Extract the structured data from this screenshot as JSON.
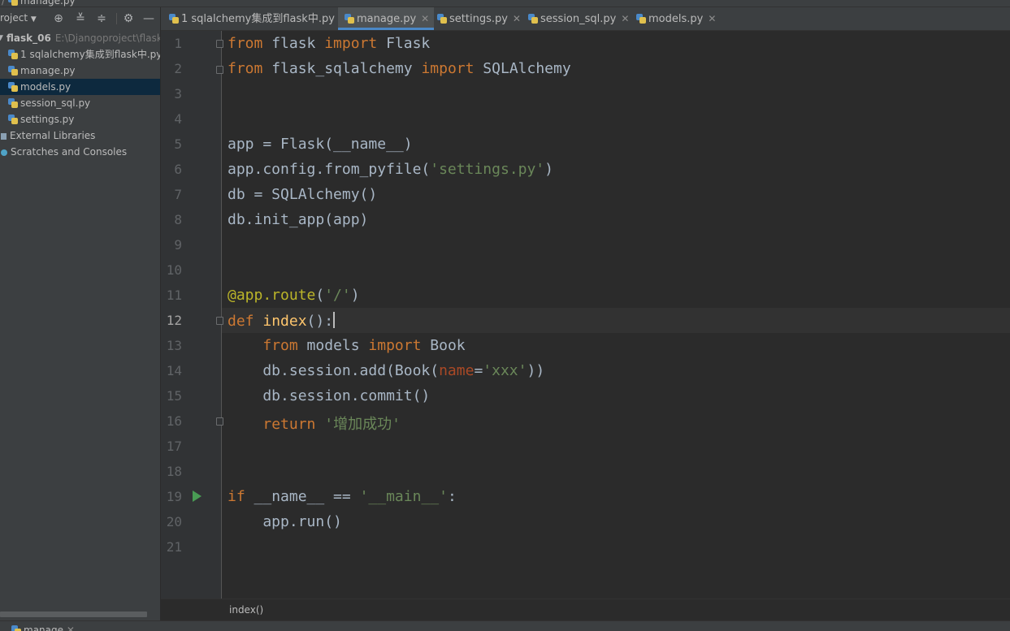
{
  "navbar": {
    "file": "manage.py"
  },
  "project_panel": {
    "title": "roject",
    "root_name": "flask_06",
    "root_path": "E:\\Djangoproject\\flask_",
    "files": [
      "1 sqlalchemy集成到flask中.py",
      "manage.py",
      "models.py",
      "session_sql.py",
      "settings.py"
    ],
    "selected": "models.py",
    "external_libraries": "External Libraries",
    "scratches": "Scratches and Consoles"
  },
  "tabs": [
    {
      "label": "1 sqlalchemy集成到flask中.py",
      "active": false
    },
    {
      "label": "manage.py",
      "active": true
    },
    {
      "label": "settings.py",
      "active": false
    },
    {
      "label": "session_sql.py",
      "active": false
    },
    {
      "label": "models.py",
      "active": false
    }
  ],
  "editor": {
    "current_line": 12,
    "lines": [
      "from flask import Flask",
      "from flask_sqlalchemy import SQLAlchemy",
      "",
      "",
      "app = Flask(__name__)",
      "app.config.from_pyfile('settings.py')",
      "db = SQLAlchemy()",
      "db.init_app(app)",
      "",
      "",
      "@app.route('/')",
      "def index():",
      "    from models import Book",
      "    db.session.add(Book(name='xxx'))",
      "    db.session.commit()",
      "    return '增加成功'",
      "",
      "",
      "if __name__ == '__main__':",
      "    app.run()",
      ""
    ]
  },
  "structure_breadcrumb": "index()",
  "run_tab": "manage",
  "colors": {
    "keyword": "#cc7832",
    "string": "#6a8759",
    "decorator": "#bbb529",
    "function": "#ffc66d",
    "parameter": "#aa4926",
    "text": "#a9b7c6",
    "selection": "#0d293e",
    "run_marker": "#499c54"
  },
  "icons": [
    "python-file-icon",
    "crosshair-icon",
    "expand-all-icon",
    "collapse-all-icon",
    "gear-icon",
    "minimize-icon",
    "close-icon",
    "run-icon",
    "fold-icon"
  ]
}
